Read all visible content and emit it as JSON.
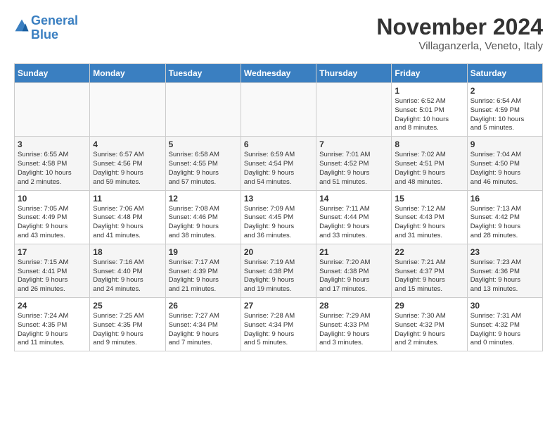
{
  "header": {
    "logo_line1": "General",
    "logo_line2": "Blue",
    "month_title": "November 2024",
    "location": "Villaganzerla, Veneto, Italy"
  },
  "days_of_week": [
    "Sunday",
    "Monday",
    "Tuesday",
    "Wednesday",
    "Thursday",
    "Friday",
    "Saturday"
  ],
  "weeks": [
    [
      {
        "day": "",
        "info": ""
      },
      {
        "day": "",
        "info": ""
      },
      {
        "day": "",
        "info": ""
      },
      {
        "day": "",
        "info": ""
      },
      {
        "day": "",
        "info": ""
      },
      {
        "day": "1",
        "info": "Sunrise: 6:52 AM\nSunset: 5:01 PM\nDaylight: 10 hours\nand 8 minutes."
      },
      {
        "day": "2",
        "info": "Sunrise: 6:54 AM\nSunset: 4:59 PM\nDaylight: 10 hours\nand 5 minutes."
      }
    ],
    [
      {
        "day": "3",
        "info": "Sunrise: 6:55 AM\nSunset: 4:58 PM\nDaylight: 10 hours\nand 2 minutes."
      },
      {
        "day": "4",
        "info": "Sunrise: 6:57 AM\nSunset: 4:56 PM\nDaylight: 9 hours\nand 59 minutes."
      },
      {
        "day": "5",
        "info": "Sunrise: 6:58 AM\nSunset: 4:55 PM\nDaylight: 9 hours\nand 57 minutes."
      },
      {
        "day": "6",
        "info": "Sunrise: 6:59 AM\nSunset: 4:54 PM\nDaylight: 9 hours\nand 54 minutes."
      },
      {
        "day": "7",
        "info": "Sunrise: 7:01 AM\nSunset: 4:52 PM\nDaylight: 9 hours\nand 51 minutes."
      },
      {
        "day": "8",
        "info": "Sunrise: 7:02 AM\nSunset: 4:51 PM\nDaylight: 9 hours\nand 48 minutes."
      },
      {
        "day": "9",
        "info": "Sunrise: 7:04 AM\nSunset: 4:50 PM\nDaylight: 9 hours\nand 46 minutes."
      }
    ],
    [
      {
        "day": "10",
        "info": "Sunrise: 7:05 AM\nSunset: 4:49 PM\nDaylight: 9 hours\nand 43 minutes."
      },
      {
        "day": "11",
        "info": "Sunrise: 7:06 AM\nSunset: 4:48 PM\nDaylight: 9 hours\nand 41 minutes."
      },
      {
        "day": "12",
        "info": "Sunrise: 7:08 AM\nSunset: 4:46 PM\nDaylight: 9 hours\nand 38 minutes."
      },
      {
        "day": "13",
        "info": "Sunrise: 7:09 AM\nSunset: 4:45 PM\nDaylight: 9 hours\nand 36 minutes."
      },
      {
        "day": "14",
        "info": "Sunrise: 7:11 AM\nSunset: 4:44 PM\nDaylight: 9 hours\nand 33 minutes."
      },
      {
        "day": "15",
        "info": "Sunrise: 7:12 AM\nSunset: 4:43 PM\nDaylight: 9 hours\nand 31 minutes."
      },
      {
        "day": "16",
        "info": "Sunrise: 7:13 AM\nSunset: 4:42 PM\nDaylight: 9 hours\nand 28 minutes."
      }
    ],
    [
      {
        "day": "17",
        "info": "Sunrise: 7:15 AM\nSunset: 4:41 PM\nDaylight: 9 hours\nand 26 minutes."
      },
      {
        "day": "18",
        "info": "Sunrise: 7:16 AM\nSunset: 4:40 PM\nDaylight: 9 hours\nand 24 minutes."
      },
      {
        "day": "19",
        "info": "Sunrise: 7:17 AM\nSunset: 4:39 PM\nDaylight: 9 hours\nand 21 minutes."
      },
      {
        "day": "20",
        "info": "Sunrise: 7:19 AM\nSunset: 4:38 PM\nDaylight: 9 hours\nand 19 minutes."
      },
      {
        "day": "21",
        "info": "Sunrise: 7:20 AM\nSunset: 4:38 PM\nDaylight: 9 hours\nand 17 minutes."
      },
      {
        "day": "22",
        "info": "Sunrise: 7:21 AM\nSunset: 4:37 PM\nDaylight: 9 hours\nand 15 minutes."
      },
      {
        "day": "23",
        "info": "Sunrise: 7:23 AM\nSunset: 4:36 PM\nDaylight: 9 hours\nand 13 minutes."
      }
    ],
    [
      {
        "day": "24",
        "info": "Sunrise: 7:24 AM\nSunset: 4:35 PM\nDaylight: 9 hours\nand 11 minutes."
      },
      {
        "day": "25",
        "info": "Sunrise: 7:25 AM\nSunset: 4:35 PM\nDaylight: 9 hours\nand 9 minutes."
      },
      {
        "day": "26",
        "info": "Sunrise: 7:27 AM\nSunset: 4:34 PM\nDaylight: 9 hours\nand 7 minutes."
      },
      {
        "day": "27",
        "info": "Sunrise: 7:28 AM\nSunset: 4:34 PM\nDaylight: 9 hours\nand 5 minutes."
      },
      {
        "day": "28",
        "info": "Sunrise: 7:29 AM\nSunset: 4:33 PM\nDaylight: 9 hours\nand 3 minutes."
      },
      {
        "day": "29",
        "info": "Sunrise: 7:30 AM\nSunset: 4:32 PM\nDaylight: 9 hours\nand 2 minutes."
      },
      {
        "day": "30",
        "info": "Sunrise: 7:31 AM\nSunset: 4:32 PM\nDaylight: 9 hours\nand 0 minutes."
      }
    ]
  ]
}
